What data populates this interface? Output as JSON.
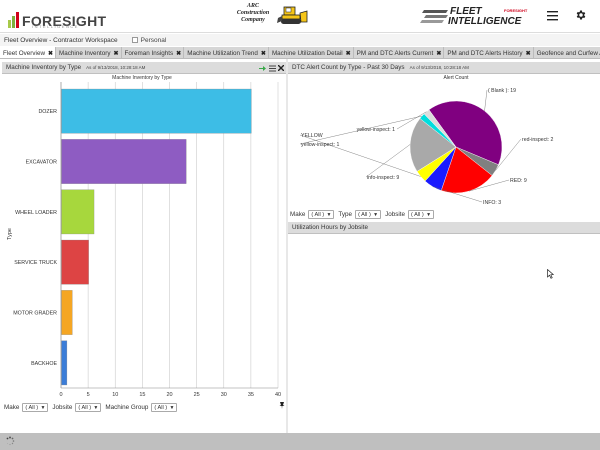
{
  "header": {
    "logo_text": "FORESIGHT",
    "logo_tagline": "INTELLIGENCE",
    "company_line1": "ARC",
    "company_line2": "Construction",
    "company_line3": "Company",
    "fi_line1": "FLEET",
    "fi_line2": "INTELLIGENCE",
    "fi_small": "FORESIGHT"
  },
  "workspace": {
    "title": "Fleet Overview - Contractor Workspace",
    "personal_label": "Personal"
  },
  "tabs": [
    {
      "label": "Fleet Overview",
      "active": true
    },
    {
      "label": "Machine Inventory",
      "active": false
    },
    {
      "label": "Foreman Insights",
      "active": false
    },
    {
      "label": "Machine Utilization Trend",
      "active": false
    },
    {
      "label": "Machine Utilization Detail",
      "active": false
    },
    {
      "label": "PM and DTC Alerts Current",
      "active": false
    },
    {
      "label": "PM and DTC Alerts History",
      "active": false
    },
    {
      "label": "Geofence and Curfew Alerts",
      "active": false
    }
  ],
  "left_panel": {
    "title": "Machine Inventory by Type",
    "as_of": "As of 9/13/2018, 10:28:18 AM",
    "filters": [
      {
        "label": "Make",
        "value": "( All )"
      },
      {
        "label": "Jobsite",
        "value": "( All )"
      },
      {
        "label": "Machine Group",
        "value": "( All )"
      }
    ]
  },
  "right_top_panel": {
    "title": "DTC Alert Count by Type - Past 30 Days",
    "as_of": "As of 9/13/2018, 10:28:18 AM",
    "filters": [
      {
        "label": "Make",
        "value": "( All )"
      },
      {
        "label": "Type",
        "value": "( All )"
      },
      {
        "label": "Jobsite",
        "value": "( All )"
      }
    ]
  },
  "right_bottom_panel": {
    "title": "Utilization Hours by Jobsite"
  },
  "chart_data": [
    {
      "type": "bar",
      "orientation": "horizontal",
      "title": "Machine Inventory by Type",
      "ylabel": "Type",
      "categories": [
        "DOZER",
        "EXCAVATOR",
        "WHEEL LOADER",
        "SERVICE TRUCK",
        "MOTOR GRADER",
        "BACKHOE"
      ],
      "values": [
        35,
        23,
        6,
        5,
        2,
        1
      ],
      "colors": [
        "#3dbde6",
        "#8e5cc2",
        "#a7d73d",
        "#dd4444",
        "#f5a623",
        "#3b7dd8"
      ],
      "xlim": [
        0,
        40
      ],
      "xticks": [
        0,
        5,
        10,
        15,
        20,
        25,
        30,
        35,
        40
      ],
      "grid": true
    },
    {
      "type": "pie",
      "title": "Alert Count",
      "slices": [
        {
          "label": "( Blank )",
          "value": 19,
          "color": "#800080"
        },
        {
          "label": "red-inspect",
          "value": 2,
          "color": "#808080"
        },
        {
          "label": "RED",
          "value": 9,
          "color": "#ff0000"
        },
        {
          "label": "INFO",
          "value": 3,
          "color": "#1a1aff"
        },
        {
          "label": "YELLOW",
          "value": 2,
          "color": "#ffff00"
        },
        {
          "label": "info-inspect",
          "value": 9,
          "color": "#a9a9a9"
        },
        {
          "label": "yellow-inspect",
          "value": 1,
          "color": "#00dddd"
        },
        {
          "label": "yellow-inspect",
          "value": 1,
          "color": "#dcdcdc"
        }
      ],
      "labels": [
        {
          "text": "( Blank ): 19"
        },
        {
          "text": "red-inspect: 2"
        },
        {
          "text": "RED: 9"
        },
        {
          "text": "INFO: 3"
        },
        {
          "text": "info-inspect: 9"
        },
        {
          "text": "yellow-inspect: 1"
        },
        {
          "text": "YELLOW"
        },
        {
          "text": "yellow-inspect: 1"
        }
      ]
    }
  ]
}
